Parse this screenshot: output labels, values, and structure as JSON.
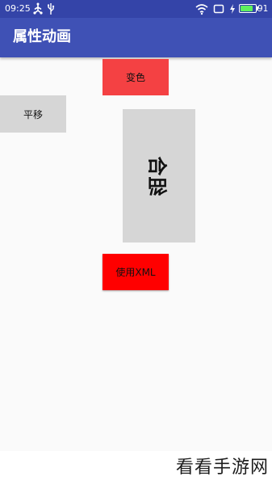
{
  "status_bar": {
    "time": "09:25",
    "battery_percent": "91",
    "battery_level": 0.91,
    "icons": [
      "usb-icon",
      "usb-debug-icon",
      "wifi-icon",
      "cast-icon",
      "charging-icon",
      "battery-icon"
    ]
  },
  "app_bar": {
    "title": "属性动画",
    "color": "#3f51b5"
  },
  "buttons": {
    "color_change": {
      "label": "变色",
      "color": "#f44143"
    },
    "translate": {
      "label": "平移",
      "color": "#d6d6d6"
    },
    "combine": {
      "label": "组合",
      "color": "#d6d6d6"
    },
    "use_xml": {
      "label": "使用XML",
      "color": "#ff0000"
    }
  },
  "watermark": "看看手游网"
}
